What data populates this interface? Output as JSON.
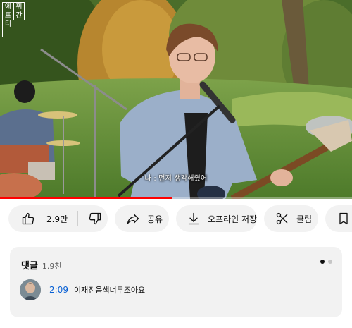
{
  "video": {
    "subtitle": "나 : 먼저 생각해줬어",
    "logo_chars_a": [
      "에",
      "프",
      "티"
    ],
    "logo_chars_b": [
      "휘",
      "간"
    ],
    "progress_fraction": 0.49,
    "progress_color": "#ff0000"
  },
  "actions": {
    "like_count": "2.9만",
    "like_icon": "thumbs-up-icon",
    "dislike_icon": "thumbs-down-icon",
    "share_label": "공유",
    "share_icon": "share-arrow-icon",
    "offline_label": "오프라인 저장",
    "offline_icon": "download-icon",
    "clip_label": "클립",
    "clip_icon": "scissors-icon",
    "save_icon": "bookmark-icon"
  },
  "comments": {
    "title": "댓글",
    "count": "1.9천",
    "carousel_active_index": 0,
    "carousel_total": 2,
    "top_comment": {
      "timestamp": "2:09",
      "text": "이재진음색너무조아요",
      "timestamp_color": "#065fd4"
    }
  }
}
